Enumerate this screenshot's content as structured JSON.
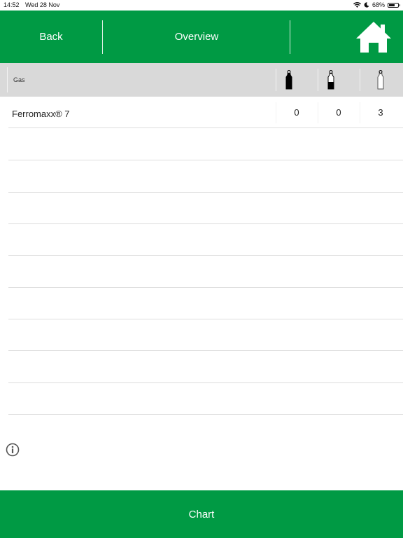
{
  "status_bar": {
    "time": "14:52",
    "date": "Wed 28 Nov",
    "battery": "68%",
    "battery_level": 0.68
  },
  "header": {
    "back_label": "Back",
    "title": "Overview",
    "home_icon": "home-icon"
  },
  "table": {
    "gas_header": "Gas",
    "columns": [
      {
        "icon": "cylinder-full-icon"
      },
      {
        "icon": "cylinder-half-icon"
      },
      {
        "icon": "cylinder-empty-icon"
      }
    ],
    "rows": [
      {
        "name": "Ferromaxx® 7",
        "values": [
          "0",
          "0",
          "3"
        ]
      }
    ]
  },
  "info_icon": "info-icon",
  "footer": {
    "chart_label": "Chart"
  },
  "colors": {
    "brand_green": "#009a44",
    "header_gray": "#d9d9d9"
  }
}
